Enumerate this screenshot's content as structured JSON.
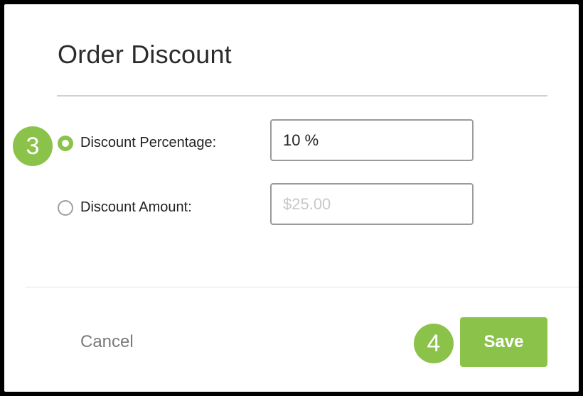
{
  "dialog": {
    "title": "Order Discount",
    "options": [
      {
        "label": "Discount Percentage:",
        "selected": true,
        "value": "10 %",
        "placeholder": ""
      },
      {
        "label": "Discount Amount:",
        "selected": false,
        "value": "",
        "placeholder": "$25.00"
      }
    ],
    "cancel_label": "Cancel",
    "save_label": "Save"
  },
  "annotations": {
    "step_3": "3",
    "step_4": "4"
  },
  "colors": {
    "accent": "#8bc34a",
    "title_text": "#2b2b2b",
    "cancel_text": "#7a7a7a"
  }
}
